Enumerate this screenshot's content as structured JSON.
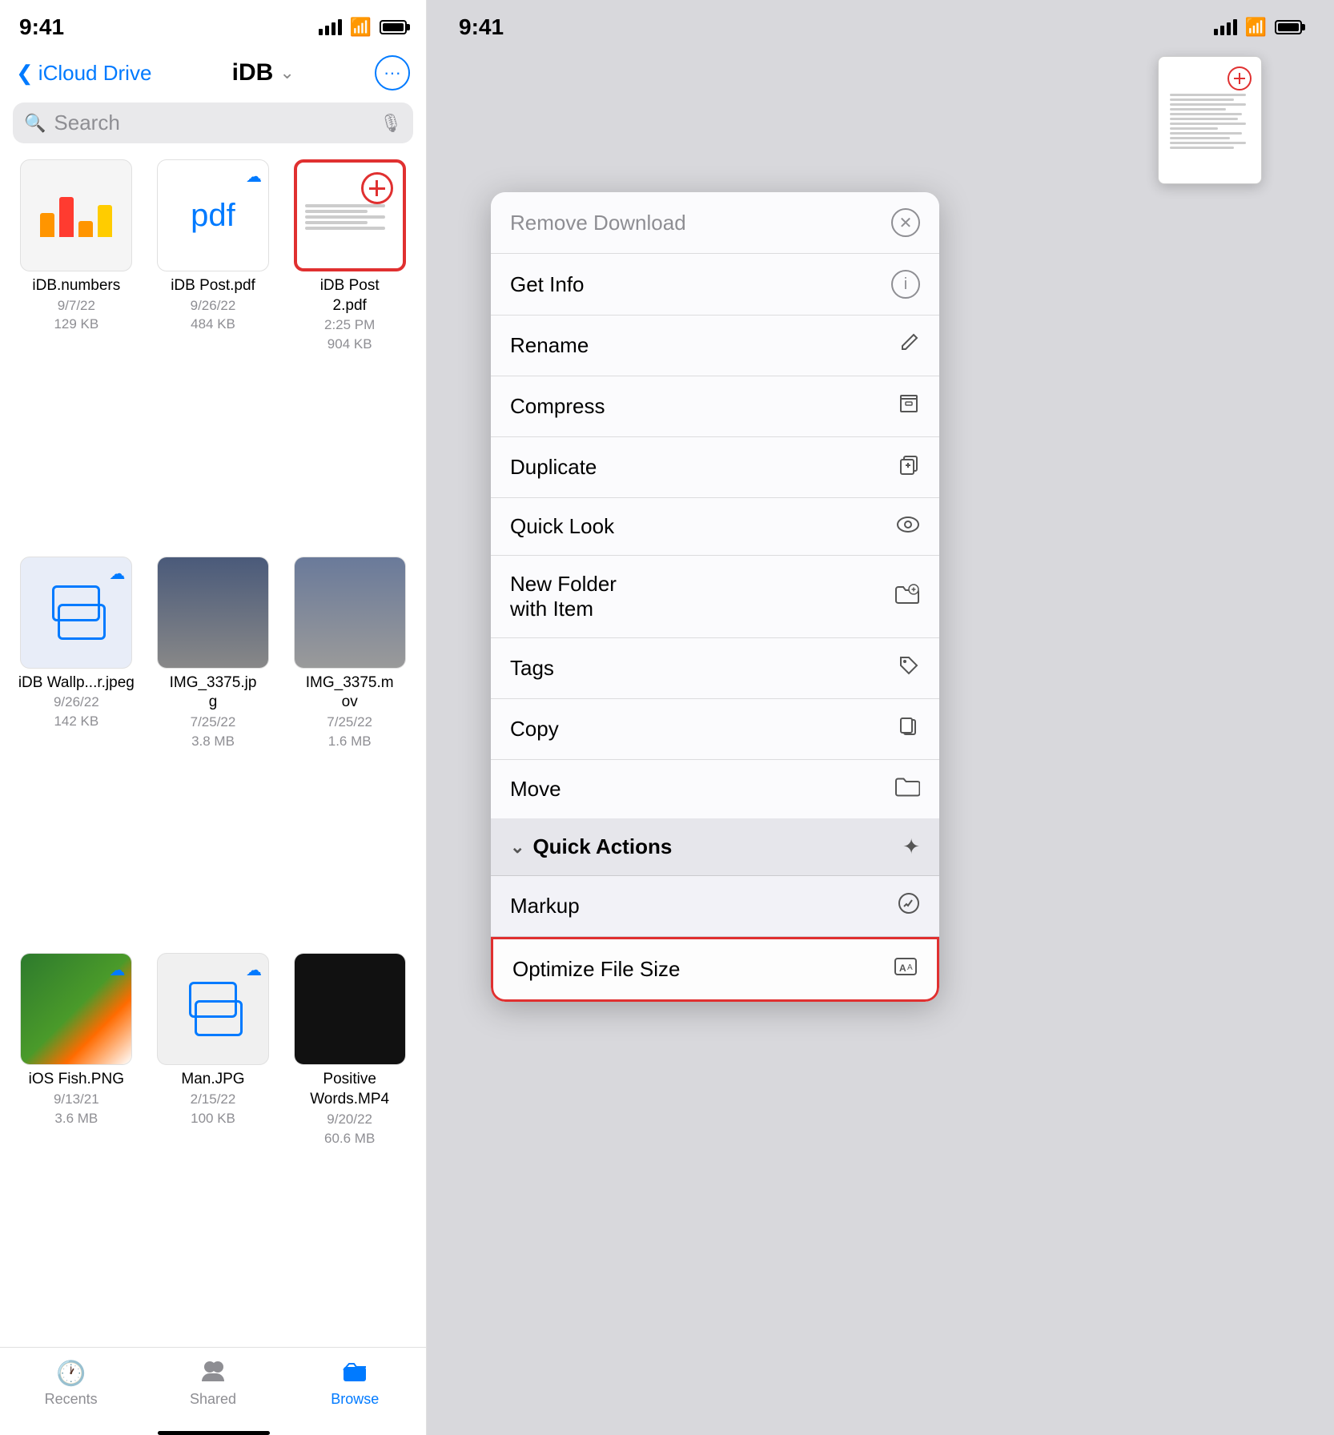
{
  "left": {
    "statusBar": {
      "time": "9:41"
    },
    "nav": {
      "backLabel": "iCloud Drive",
      "title": "iDB",
      "moreIcon": "•••"
    },
    "search": {
      "placeholder": "Search"
    },
    "files": [
      {
        "id": "idb-numbers",
        "name": "iDB.numbers",
        "date": "9/7/22",
        "size": "129 KB",
        "selected": false,
        "type": "numbers"
      },
      {
        "id": "idb-post-pdf",
        "name": "iDB Post.pdf",
        "date": "9/26/22",
        "size": "484 KB",
        "selected": false,
        "type": "pdf",
        "cloudBadge": true
      },
      {
        "id": "idb-post2-pdf",
        "name": "iDB Post 2.pdf",
        "date": "2:25 PM",
        "size": "904 KB",
        "selected": true,
        "type": "pdf2"
      },
      {
        "id": "idb-wallpaper",
        "name": "iDB Wallp...r.jpeg",
        "date": "9/26/22",
        "size": "142 KB",
        "selected": false,
        "type": "wallpaper",
        "cloudBadge": true
      },
      {
        "id": "img-3375-jpg",
        "name": "IMG_3375.jpg",
        "date": "7/25/22",
        "size": "3.8 MB",
        "selected": false,
        "type": "photo-curtain"
      },
      {
        "id": "img-3375-mov",
        "name": "IMG_3375.mov",
        "date": "7/25/22",
        "size": "1.6 MB",
        "selected": false,
        "type": "photo-curtain2"
      },
      {
        "id": "ios-fish",
        "name": "iOS Fish.PNG",
        "date": "9/13/21",
        "size": "3.6 MB",
        "selected": false,
        "type": "photo-clownfish",
        "cloudBadge": true
      },
      {
        "id": "man-jpg",
        "name": "Man.JPG",
        "date": "2/15/22",
        "size": "100 KB",
        "selected": false,
        "type": "wallpaper2",
        "cloudBadge": true
      },
      {
        "id": "positive-words",
        "name": "Positive Words.MP4",
        "date": "9/20/22",
        "size": "60.6 MB",
        "selected": false,
        "type": "photo-dark"
      }
    ],
    "tabs": [
      {
        "id": "recents",
        "label": "Recents",
        "icon": "🕐",
        "active": false
      },
      {
        "id": "shared",
        "label": "Shared",
        "icon": "👥",
        "active": false
      },
      {
        "id": "browse",
        "label": "Browse",
        "icon": "📁",
        "active": true
      }
    ]
  },
  "right": {
    "statusBar": {
      "time": "9:41"
    },
    "contextMenu": {
      "items": [
        {
          "id": "remove-download",
          "label": "Remove Download",
          "icon": "✕-circle",
          "destructive": true
        },
        {
          "id": "get-info",
          "label": "Get Info",
          "icon": "ℹ-circle"
        },
        {
          "id": "rename",
          "label": "Rename",
          "icon": "pencil"
        },
        {
          "id": "compress",
          "label": "Compress",
          "icon": "archive"
        },
        {
          "id": "duplicate",
          "label": "Duplicate",
          "icon": "duplicate"
        },
        {
          "id": "quick-look",
          "label": "Quick Look",
          "icon": "eye"
        },
        {
          "id": "new-folder-item",
          "label": "New Folder with Item",
          "icon": "folder-plus"
        },
        {
          "id": "tags",
          "label": "Tags",
          "icon": "tag"
        },
        {
          "id": "copy",
          "label": "Copy",
          "icon": "copy"
        },
        {
          "id": "move",
          "label": "Move",
          "icon": "folder"
        }
      ],
      "quickActions": {
        "title": "Quick Actions",
        "items": [
          {
            "id": "markup",
            "label": "Markup",
            "icon": "markup"
          },
          {
            "id": "optimize-file-size",
            "label": "Optimize File Size",
            "icon": "optimize",
            "highlighted": true
          }
        ]
      }
    }
  }
}
